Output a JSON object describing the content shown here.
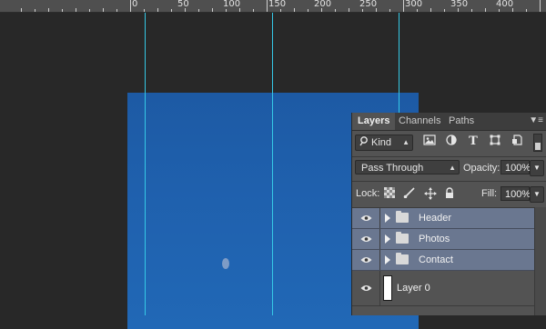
{
  "ruler": {
    "labels": [
      "0",
      "50",
      "100",
      "150",
      "200",
      "250",
      "300",
      "350",
      "400"
    ]
  },
  "panel": {
    "tabs": [
      "Layers",
      "Channels",
      "Paths"
    ],
    "menu_icon": "panel-menu-icon",
    "filter": {
      "kind_label": "Kind",
      "icons": [
        "pixel-layer-filter-icon",
        "adjustment-layer-filter-icon",
        "type-layer-filter-icon",
        "shape-layer-filter-icon",
        "smart-object-filter-icon"
      ]
    },
    "blend_mode": "Pass Through",
    "opacity_label": "Opacity:",
    "opacity_value": "100%",
    "lock_label": "Lock:",
    "lock_icons": [
      "lock-transparent-pixels-icon",
      "lock-image-pixels-icon",
      "lock-position-icon",
      "lock-all-icon"
    ],
    "fill_label": "Fill:",
    "fill_value": "100%"
  },
  "layers": [
    {
      "name": "Header",
      "type": "group",
      "visible": true
    },
    {
      "name": "Photos",
      "type": "group",
      "visible": true
    },
    {
      "name": "Contact",
      "type": "group",
      "visible": true
    },
    {
      "name": "Layer 0",
      "type": "layer",
      "visible": true
    }
  ],
  "colors": {
    "guide": "#35c9e6",
    "selected_layer": "#6a7790",
    "document_sky": "#1f60ad"
  }
}
